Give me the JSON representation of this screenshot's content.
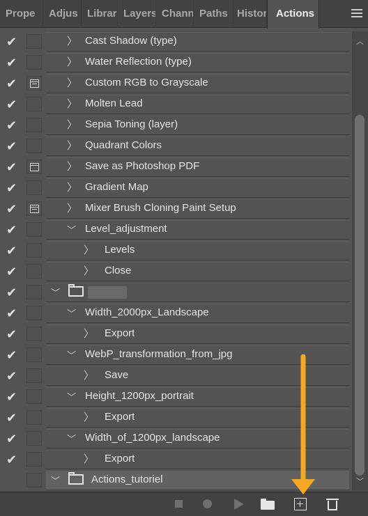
{
  "tabs": [
    {
      "label": "Prope",
      "active": false
    },
    {
      "label": "Adjus",
      "active": false
    },
    {
      "label": "Librar",
      "active": false
    },
    {
      "label": "Layers",
      "active": false
    },
    {
      "label": "Chann",
      "active": false
    },
    {
      "label": "Paths",
      "active": false
    },
    {
      "label": "Histor",
      "active": false
    },
    {
      "label": "Actions",
      "active": true
    }
  ],
  "rows": [
    {
      "label": "Cast Shadow (type)",
      "check": "✔",
      "dialog": "none",
      "indent": 1,
      "expanded": false
    },
    {
      "label": "Water Reflection (type)",
      "check": "✔",
      "dialog": "none",
      "indent": 1,
      "expanded": false
    },
    {
      "label": "Custom RGB to Grayscale",
      "check": "✔",
      "dialog": "partial",
      "indent": 1,
      "expanded": false
    },
    {
      "label": "Molten Lead",
      "check": "✔",
      "dialog": "none",
      "indent": 1,
      "expanded": false
    },
    {
      "label": "Sepia Toning (layer)",
      "check": "✔",
      "dialog": "none",
      "indent": 1,
      "expanded": false
    },
    {
      "label": "Quadrant Colors",
      "check": "✔",
      "dialog": "none",
      "indent": 1,
      "expanded": false
    },
    {
      "label": "Save as Photoshop PDF",
      "check": "✔",
      "dialog": "full",
      "indent": 1,
      "expanded": false
    },
    {
      "label": "Gradient Map",
      "check": "✔",
      "dialog": "none",
      "indent": 1,
      "expanded": false
    },
    {
      "label": "Mixer Brush Cloning Paint Setup",
      "check": "✔",
      "dialog": "partial",
      "indent": 1,
      "expanded": false
    },
    {
      "label": "Level_adjustment",
      "check": "✔",
      "dialog": "none",
      "indent": 1,
      "expanded": true
    },
    {
      "label": "Levels",
      "check": "✔",
      "dialog": "none",
      "indent": 2,
      "expanded": false
    },
    {
      "label": "Close",
      "check": "✔",
      "dialog": "none",
      "indent": 2,
      "expanded": false
    },
    {
      "label": "",
      "check": "✔",
      "dialog": "none",
      "indent": 0,
      "expanded": true,
      "folder": true,
      "blurred": true
    },
    {
      "label": "Width_2000px_Landscape",
      "check": "✔",
      "dialog": "none",
      "indent": 1,
      "expanded": true
    },
    {
      "label": "Export",
      "check": "✔",
      "dialog": "none",
      "indent": 2,
      "expanded": false
    },
    {
      "label": "WebP_transformation_from_jpg",
      "check": "✔",
      "dialog": "none",
      "indent": 1,
      "expanded": true
    },
    {
      "label": "Save",
      "check": "✔",
      "dialog": "none",
      "indent": 2,
      "expanded": false
    },
    {
      "label": "Height_1200px_portrait",
      "check": "✔",
      "dialog": "none",
      "indent": 1,
      "expanded": true
    },
    {
      "label": "Export",
      "check": "✔",
      "dialog": "none",
      "indent": 2,
      "expanded": false
    },
    {
      "label": "Width_of_1200px_landscape",
      "check": "✔",
      "dialog": "none",
      "indent": 1,
      "expanded": true
    },
    {
      "label": "Export",
      "check": "✔",
      "dialog": "none",
      "indent": 2,
      "expanded": false
    },
    {
      "label": "Actions_tutoriel",
      "check": "",
      "dialog": "none",
      "indent": 0,
      "expanded": true,
      "folder": true,
      "selected": true
    }
  ],
  "icons": {
    "expanded": "﹀",
    "collapsed": "〉"
  },
  "colors": {
    "annotation_arrow": "#f5a623",
    "panel_bg": "#535353"
  }
}
